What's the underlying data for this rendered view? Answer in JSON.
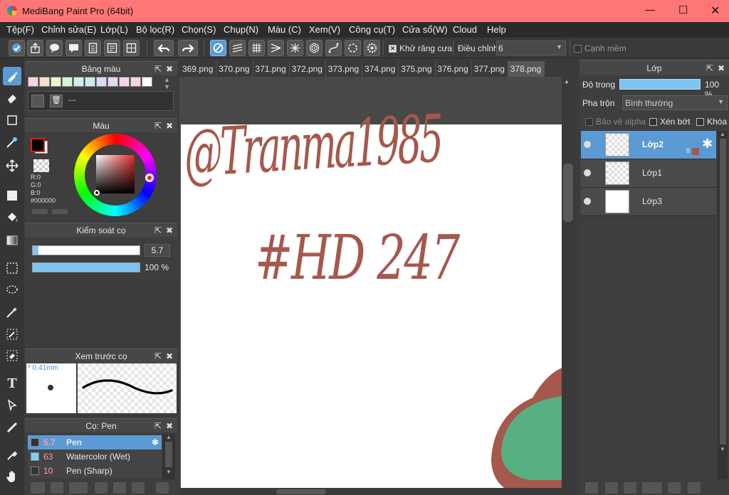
{
  "window": {
    "title": "MediBang Paint Pro (64bit)",
    "minimize": "—",
    "maximize": "☐",
    "close": "✕"
  },
  "menu": [
    "Tệp(F)",
    "Chỉnh sửa(E)",
    "Lớp(L)",
    "Bộ lọc(R)",
    "Chọn(S)",
    "Chụp(N)",
    "Màu (C)",
    "Xem(V)",
    "Công cụ(T)",
    "Cửa sổ(W)",
    "Cloud",
    "Help"
  ],
  "toolbar": {
    "antialias_label": "Khử răng cưa",
    "adjust_label": "Điều chỉnh",
    "adjust_value": "6",
    "soft_edge_label": "Cạnh mềm"
  },
  "palette": {
    "title": "Bảng màu",
    "name": "---",
    "swatches": [
      "#f4d7d7",
      "#f2e1cf",
      "#eef2cf",
      "#d7f1d2",
      "#d3efe4",
      "#d1e8f2",
      "#d6dcf3",
      "#e5d8f2",
      "#f2d5e8",
      "#f5d8d8",
      "#ffffff"
    ]
  },
  "color": {
    "title": "Màu",
    "r": "R:0",
    "g": "G:0",
    "b": "B:0",
    "hex": "#000000",
    "fg": "#000000",
    "bg": "#ffffff"
  },
  "brush_control": {
    "title": "Kiểm soát cọ",
    "size": "5.7",
    "opacity": "100 %",
    "size_fraction": 0.05,
    "opacity_fraction": 1.0
  },
  "brush_preview": {
    "title": "Xem trước cọ",
    "size": "* 0.41mm"
  },
  "brush": {
    "title": "Cọ: Pen",
    "items": [
      {
        "size": "5.7",
        "name": "Pen",
        "color": "#333333",
        "selected": true
      },
      {
        "size": "63",
        "name": "Watercolor (Wet)",
        "color": "#7fd1f0",
        "selected": false
      },
      {
        "size": "10",
        "name": "Pen (Sharp)",
        "color": "#333333",
        "selected": false
      }
    ]
  },
  "tabs": [
    "369.png",
    "370.png",
    "371.png",
    "372.png",
    "373.png",
    "374.png",
    "375.png",
    "376.png",
    "377.png",
    "378.png"
  ],
  "active_tab": "378.png",
  "canvas": {
    "line1": "@Tranma1985",
    "line2": "#HD 247",
    "ink": "#a5584b",
    "fill": "#57b07f"
  },
  "layer_panel": {
    "title": "Lớp",
    "opacity_label": "Độ trong",
    "opacity_value": "100 %",
    "blend_label": "Pha trộn",
    "blend_value": "Bình thường",
    "protect_alpha": "Bảo vệ alpha",
    "clipping": "Xén bớt",
    "lock": "Khóa",
    "layers": [
      {
        "name": "Lớp2",
        "badge": "8",
        "selected": true
      },
      {
        "name": "Lớp1",
        "selected": false
      },
      {
        "name": "Lớp3",
        "selected": false
      }
    ]
  }
}
